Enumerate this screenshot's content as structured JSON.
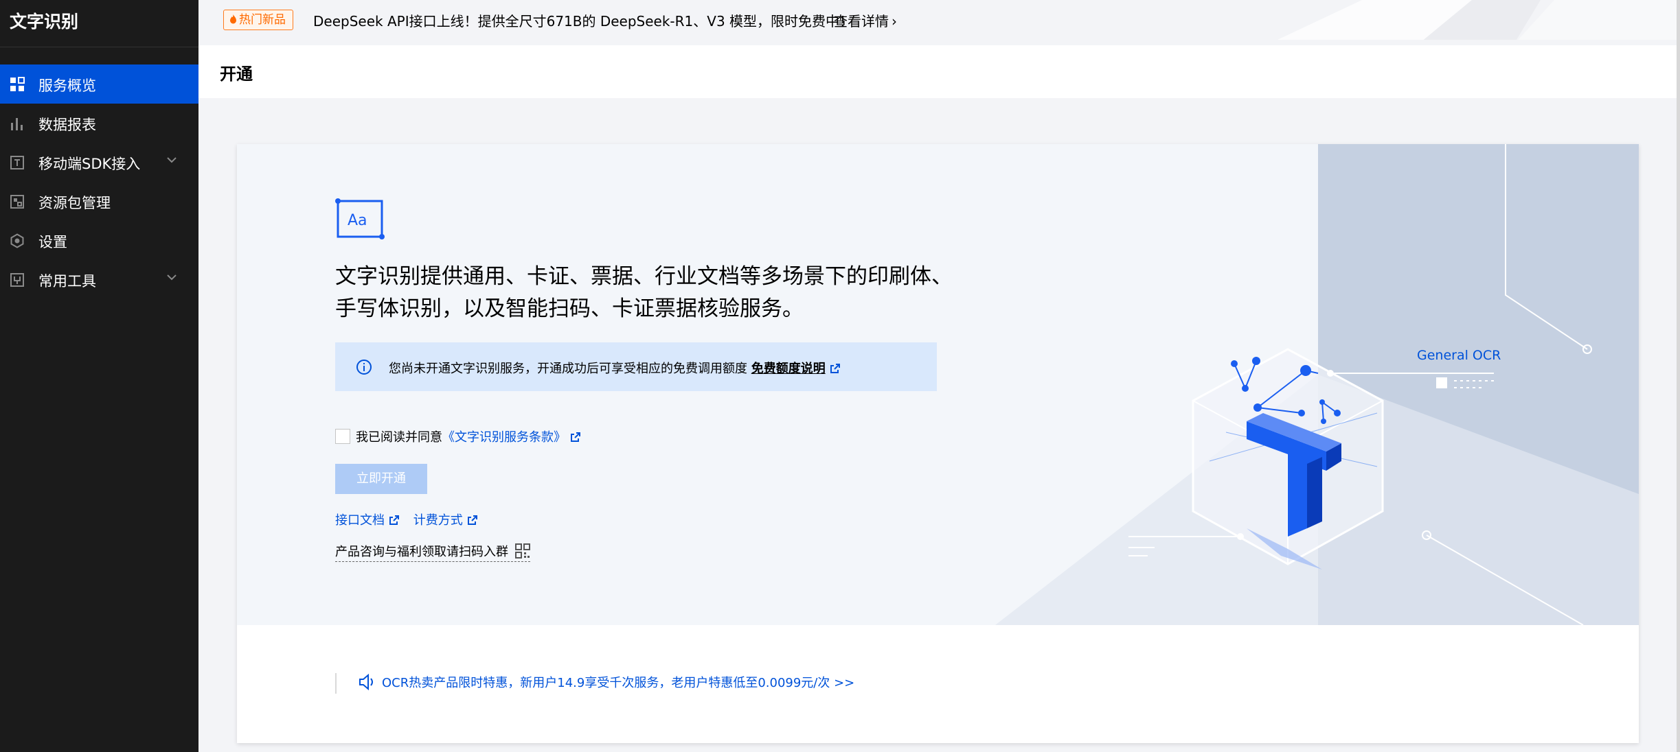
{
  "sidebar": {
    "title": "文字识别",
    "items": [
      {
        "label": "服务概览",
        "icon": "dashboard-icon",
        "active": true
      },
      {
        "label": "数据报表",
        "icon": "bar-chart-icon"
      },
      {
        "label": "移动端SDK接入",
        "icon": "sdk-icon",
        "expandable": true
      },
      {
        "label": "资源包管理",
        "icon": "package-icon"
      },
      {
        "label": "设置",
        "icon": "settings-icon"
      },
      {
        "label": "常用工具",
        "icon": "tools-icon",
        "expandable": true
      }
    ]
  },
  "announcement": {
    "tag": "热门新品",
    "text": "DeepSeek API接口上线！提供全尺寸671B的 DeepSeek-R1、V3 模型，限时免费中！",
    "link": "查看详情",
    "close_icon": "close-icon"
  },
  "header": {
    "title": "开通"
  },
  "hero": {
    "headline_line1": "文字识别提供通用、卡证、票据、行业文档等多场景下的印刷体、",
    "headline_line2": "手写体识别，以及智能扫码、卡证票据核验服务。",
    "info_text": "您尚未开通文字识别服务，开通成功后可享受相应的免费调用额度",
    "info_link": "免费额度说明",
    "agree_text": "我已阅读并同意",
    "agree_link": "《文字识别服务条款》",
    "open_button": "立即开通",
    "doc_link": "接口文档",
    "pricing_link": "计费方式",
    "consult_text": "产品咨询与福利领取请扫码入群",
    "illustration_label": "General OCR"
  },
  "promo": {
    "text": "OCR热卖产品限时特惠，新用户14.9享受千次服务，老用户特惠低至0.0099元/次 >>"
  },
  "colors": {
    "sidebar_bg": "#1b1b1b",
    "accent": "#0052d9",
    "info_bg": "#d9e8fc",
    "hot_tag": "#ff6a00",
    "disabled_button": "#aecbf6"
  }
}
